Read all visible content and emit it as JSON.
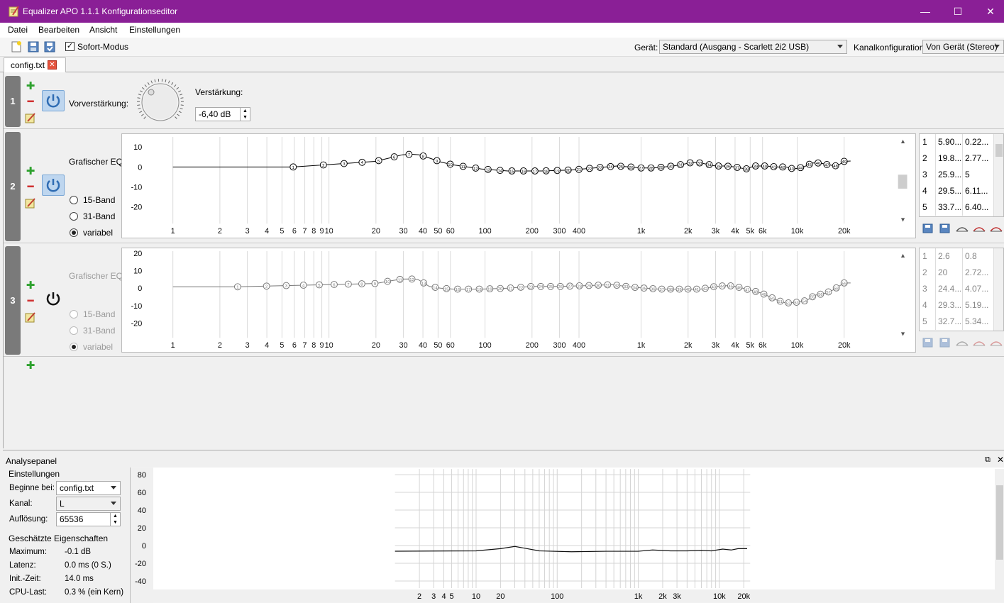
{
  "window": {
    "title": "Equalizer APO 1.1.1 Konfigurationseditor",
    "minimize": "—",
    "maximize": "☐",
    "close": "✕"
  },
  "menu": [
    "Datei",
    "Bearbeiten",
    "Ansicht",
    "Einstellungen"
  ],
  "toolbar": {
    "instant_mode_label": "Sofort-Modus",
    "instant_mode_checked": true,
    "device_label": "Gerät:",
    "device_value": "Standard (Ausgang - Scarlett 2i2 USB)",
    "channel_config_label": "Kanalkonfiguration:",
    "channel_config_value": "Von Gerät (Stereo)"
  },
  "tabs": [
    {
      "label": "config.txt"
    }
  ],
  "filters": {
    "f1": {
      "number": "1",
      "preamp_label": "Vorverstärkung:",
      "gain_label": "Verstärkung:",
      "gain_value": "-6,40 dB"
    },
    "f2": {
      "number": "2",
      "title": "Grafischer EQ:",
      "modes": [
        "15-Band",
        "31-Band",
        "variabel"
      ],
      "selected_mode": "variabel",
      "table": [
        [
          "1",
          "5.90...",
          "0.22..."
        ],
        [
          "2",
          "19.8...",
          "2.77..."
        ],
        [
          "3",
          "25.9...",
          "5"
        ],
        [
          "4",
          "29.5...",
          "6.11..."
        ],
        [
          "5",
          "33.7...",
          "6.40..."
        ]
      ]
    },
    "f3": {
      "number": "3",
      "title": "Grafischer EQ:",
      "modes": [
        "15-Band",
        "31-Band",
        "variabel"
      ],
      "selected_mode": "variabel",
      "table": [
        [
          "1",
          "2.6",
          "0.8"
        ],
        [
          "2",
          "20",
          "2.72..."
        ],
        [
          "3",
          "24.4...",
          "4.07..."
        ],
        [
          "4",
          "29.3...",
          "5.19..."
        ],
        [
          "5",
          "32.7...",
          "5.34..."
        ]
      ]
    }
  },
  "eq_axes": {
    "x_ticks": [
      "1",
      "2",
      "3",
      "4",
      "5",
      "6",
      "7",
      "8",
      "9",
      "10",
      "20",
      "30",
      "40",
      "50",
      "60",
      "100",
      "200",
      "300",
      "400",
      "1k",
      "2k",
      "3k",
      "4k",
      "5k",
      "6k",
      "10k",
      "20k"
    ],
    "x_values": [
      1,
      2,
      3,
      4,
      5,
      6,
      7,
      8,
      9,
      10,
      20,
      30,
      40,
      50,
      60,
      100,
      200,
      300,
      400,
      1000,
      2000,
      3000,
      4000,
      5000,
      6000,
      10000,
      20000
    ],
    "y2_ticks": [
      "10",
      "0",
      "-10",
      "-20"
    ],
    "y3_ticks": [
      "20",
      "10",
      "0",
      "-10",
      "-20"
    ]
  },
  "chart_data": [
    {
      "type": "line",
      "name": "eq2",
      "points": [
        [
          5.9,
          0
        ],
        [
          19.8,
          2.8
        ],
        [
          25.9,
          5
        ],
        [
          29.5,
          6.1
        ],
        [
          33.7,
          6.4
        ],
        [
          38,
          6.1
        ],
        [
          44,
          4.5
        ],
        [
          52,
          2.5
        ],
        [
          63,
          1
        ],
        [
          95,
          -1
        ],
        [
          140,
          -2
        ],
        [
          230,
          -2
        ],
        [
          360,
          -1.5
        ],
        [
          500,
          -0.5
        ],
        [
          700,
          0.5
        ],
        [
          850,
          0
        ],
        [
          1000,
          -0.5
        ],
        [
          1200,
          -0.5
        ],
        [
          1400,
          0
        ],
        [
          1600,
          0.5
        ],
        [
          1900,
          1.5
        ],
        [
          2100,
          2.2
        ],
        [
          2300,
          2.2
        ],
        [
          2600,
          1.5
        ],
        [
          3000,
          0.5
        ],
        [
          3500,
          0.5
        ],
        [
          4000,
          0
        ],
        [
          4700,
          -1
        ],
        [
          5300,
          0.5
        ],
        [
          6300,
          0.5
        ],
        [
          7500,
          0
        ],
        [
          8500,
          0
        ],
        [
          9500,
          -1
        ],
        [
          11000,
          0
        ],
        [
          12500,
          2
        ],
        [
          14000,
          2
        ],
        [
          16000,
          1
        ],
        [
          18000,
          0.5
        ],
        [
          20000,
          2.8
        ],
        [
          22000,
          3
        ]
      ],
      "labeled_points": 49
    },
    {
      "type": "line",
      "name": "eq3",
      "points": [
        [
          2.6,
          0.8
        ],
        [
          20,
          2.7
        ],
        [
          24.4,
          4.1
        ],
        [
          29.3,
          5.2
        ],
        [
          32.7,
          5.3
        ],
        [
          37,
          5.1
        ],
        [
          44,
          1
        ],
        [
          52,
          0
        ],
        [
          63,
          -0.5
        ],
        [
          95,
          -0.5
        ],
        [
          140,
          0
        ],
        [
          200,
          1
        ],
        [
          300,
          1
        ],
        [
          450,
          1.5
        ],
        [
          650,
          2
        ],
        [
          900,
          0.5
        ],
        [
          1300,
          -0.5
        ],
        [
          1800,
          -0.5
        ],
        [
          2400,
          -0.5
        ],
        [
          3000,
          1
        ],
        [
          3600,
          1.5
        ],
        [
          4000,
          1
        ],
        [
          5000,
          -1
        ],
        [
          6000,
          -3
        ],
        [
          7500,
          -7
        ],
        [
          8500,
          -8.5
        ],
        [
          10000,
          -8
        ],
        [
          11500,
          -7
        ],
        [
          13000,
          -4
        ],
        [
          15000,
          -3
        ],
        [
          17000,
          -1
        ],
        [
          20000,
          3
        ],
        [
          22000,
          3
        ]
      ],
      "labeled_points": 59
    },
    {
      "type": "line",
      "name": "analysis",
      "ylim": [
        -40,
        80
      ],
      "y_ticks": [
        "80",
        "60",
        "40",
        "20",
        "0",
        "-20",
        "-40"
      ],
      "x_ticks": [
        "2",
        "3",
        "4",
        "5",
        "10",
        "20",
        "100",
        "1k",
        "2k",
        "3k",
        "10k",
        "20k"
      ],
      "x_values": [
        2,
        3,
        4,
        5,
        10,
        20,
        100,
        1000,
        2000,
        3000,
        10000,
        20000
      ],
      "points": [
        [
          1,
          -6.4
        ],
        [
          10,
          -6
        ],
        [
          20,
          -3.5
        ],
        [
          30,
          -1
        ],
        [
          40,
          -3
        ],
        [
          60,
          -6
        ],
        [
          150,
          -7
        ],
        [
          400,
          -6.5
        ],
        [
          1000,
          -6.5
        ],
        [
          1500,
          -5
        ],
        [
          2500,
          -6
        ],
        [
          4000,
          -6
        ],
        [
          6000,
          -5.5
        ],
        [
          8000,
          -6
        ],
        [
          11000,
          -4
        ],
        [
          14000,
          -5
        ],
        [
          17000,
          -3.5
        ],
        [
          22000,
          -3.5
        ]
      ]
    }
  ],
  "analysis": {
    "title": "Analysepanel",
    "settings_title": "Einstellungen",
    "start_label": "Beginne bei:",
    "start_value": "config.txt",
    "channel_label": "Kanal:",
    "channel_value": "L",
    "resolution_label": "Auflösung:",
    "resolution_value": "65536",
    "props_title": "Geschätzte Eigenschaften",
    "props": [
      [
        "Maximum:",
        "-0.1 dB"
      ],
      [
        "Latenz:",
        "0.0 ms (0 S.)"
      ],
      [
        "Init.-Zeit:",
        "14.0 ms"
      ],
      [
        "CPU-Last:",
        "0.3 % (ein Kern)"
      ]
    ]
  }
}
